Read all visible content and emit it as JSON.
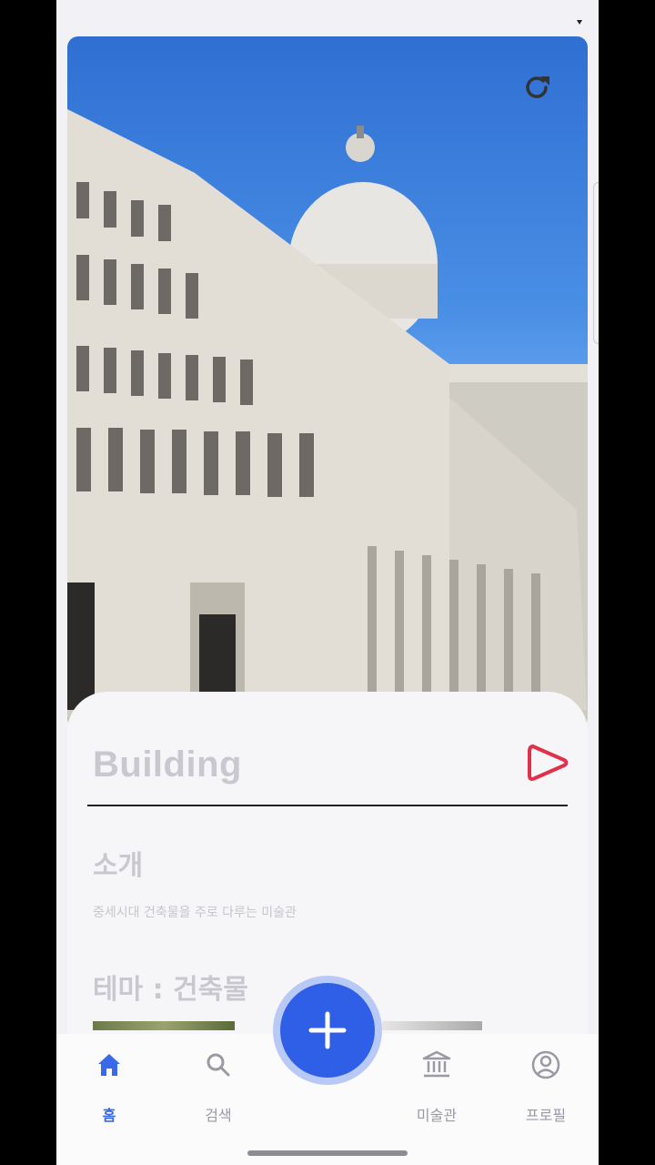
{
  "hero": {
    "refresh_icon": "refresh-icon"
  },
  "detail": {
    "title": "Building",
    "play_icon": "play-icon",
    "intro_heading": "소개",
    "intro_text": "중세시대 건축물을 주로 다루는 미술관",
    "theme_heading": "테마 : 건축물"
  },
  "tabbar": {
    "items": [
      {
        "label": "홈",
        "icon": "home-icon",
        "active": true
      },
      {
        "label": "검색",
        "icon": "search-icon",
        "active": false
      },
      {
        "label": "미술관",
        "icon": "museum-icon",
        "active": false
      },
      {
        "label": "프로필",
        "icon": "profile-icon",
        "active": false
      }
    ],
    "fab_icon": "plus-icon"
  },
  "colors": {
    "accent": "#2f5fe6",
    "play": "#e0304a",
    "muted_text": "#c9c8d0"
  }
}
